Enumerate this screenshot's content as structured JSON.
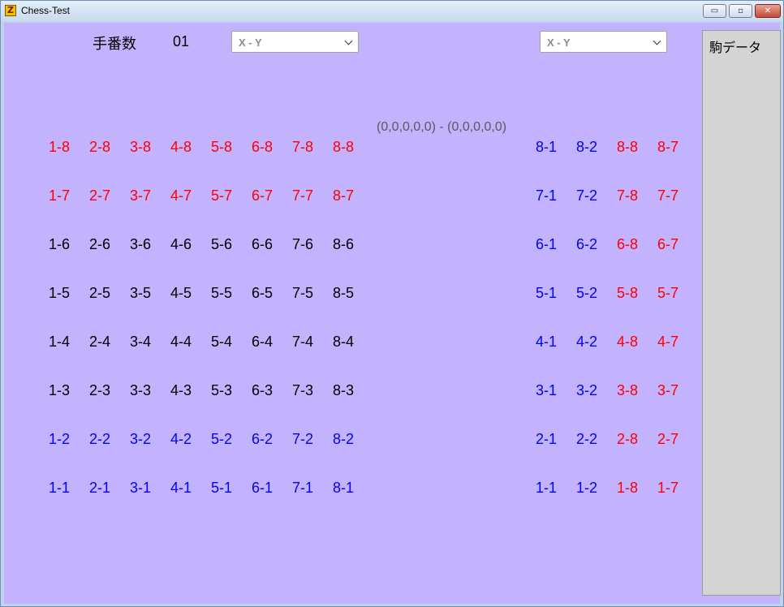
{
  "window": {
    "title": "Chess-Test",
    "min_glyph": "▭",
    "max_glyph": "▫",
    "close_glyph": "✕"
  },
  "header": {
    "moves_label": "手番数",
    "move_count": "01",
    "select_left": "X - Y",
    "select_right": "X - Y"
  },
  "coords_text": "(0,0,0,0,0) - (0,0,0,0,0)",
  "side_panel": {
    "title": "駒データ"
  },
  "colors": {
    "red": "#ff0000",
    "blue": "#0000ff",
    "black": "#000000"
  },
  "board": {
    "rows": [
      {
        "color": "red",
        "cells": [
          "1-8",
          "2-8",
          "3-8",
          "4-8",
          "5-8",
          "6-8",
          "7-8",
          "8-8"
        ]
      },
      {
        "color": "red",
        "cells": [
          "1-7",
          "2-7",
          "3-7",
          "4-7",
          "5-7",
          "6-7",
          "7-7",
          "8-7"
        ]
      },
      {
        "color": "black",
        "cells": [
          "1-6",
          "2-6",
          "3-6",
          "4-6",
          "5-6",
          "6-6",
          "7-6",
          "8-6"
        ]
      },
      {
        "color": "black",
        "cells": [
          "1-5",
          "2-5",
          "3-5",
          "4-5",
          "5-5",
          "6-5",
          "7-5",
          "8-5"
        ]
      },
      {
        "color": "black",
        "cells": [
          "1-4",
          "2-4",
          "3-4",
          "4-4",
          "5-4",
          "6-4",
          "7-4",
          "8-4"
        ]
      },
      {
        "color": "black",
        "cells": [
          "1-3",
          "2-3",
          "3-3",
          "4-3",
          "5-3",
          "6-3",
          "7-3",
          "8-3"
        ]
      },
      {
        "color": "blue",
        "cells": [
          "1-2",
          "2-2",
          "3-2",
          "4-2",
          "5-2",
          "6-2",
          "7-2",
          "8-2"
        ]
      },
      {
        "color": "blue",
        "cells": [
          "1-1",
          "2-1",
          "3-1",
          "4-1",
          "5-1",
          "6-1",
          "7-1",
          "8-1"
        ]
      }
    ]
  },
  "captured": {
    "rows": [
      [
        [
          "8-1",
          "blue"
        ],
        [
          "8-2",
          "blue"
        ],
        [
          "8-8",
          "red"
        ],
        [
          "8-7",
          "red"
        ]
      ],
      [
        [
          "7-1",
          "blue"
        ],
        [
          "7-2",
          "blue"
        ],
        [
          "7-8",
          "red"
        ],
        [
          "7-7",
          "red"
        ]
      ],
      [
        [
          "6-1",
          "blue"
        ],
        [
          "6-2",
          "blue"
        ],
        [
          "6-8",
          "red"
        ],
        [
          "6-7",
          "red"
        ]
      ],
      [
        [
          "5-1",
          "blue"
        ],
        [
          "5-2",
          "blue"
        ],
        [
          "5-8",
          "red"
        ],
        [
          "5-7",
          "red"
        ]
      ],
      [
        [
          "4-1",
          "blue"
        ],
        [
          "4-2",
          "blue"
        ],
        [
          "4-8",
          "red"
        ],
        [
          "4-7",
          "red"
        ]
      ],
      [
        [
          "3-1",
          "blue"
        ],
        [
          "3-2",
          "blue"
        ],
        [
          "3-8",
          "red"
        ],
        [
          "3-7",
          "red"
        ]
      ],
      [
        [
          "2-1",
          "blue"
        ],
        [
          "2-2",
          "blue"
        ],
        [
          "2-8",
          "red"
        ],
        [
          "2-7",
          "red"
        ]
      ],
      [
        [
          "1-1",
          "blue"
        ],
        [
          "1-2",
          "blue"
        ],
        [
          "1-8",
          "red"
        ],
        [
          "1-7",
          "red"
        ]
      ]
    ]
  }
}
